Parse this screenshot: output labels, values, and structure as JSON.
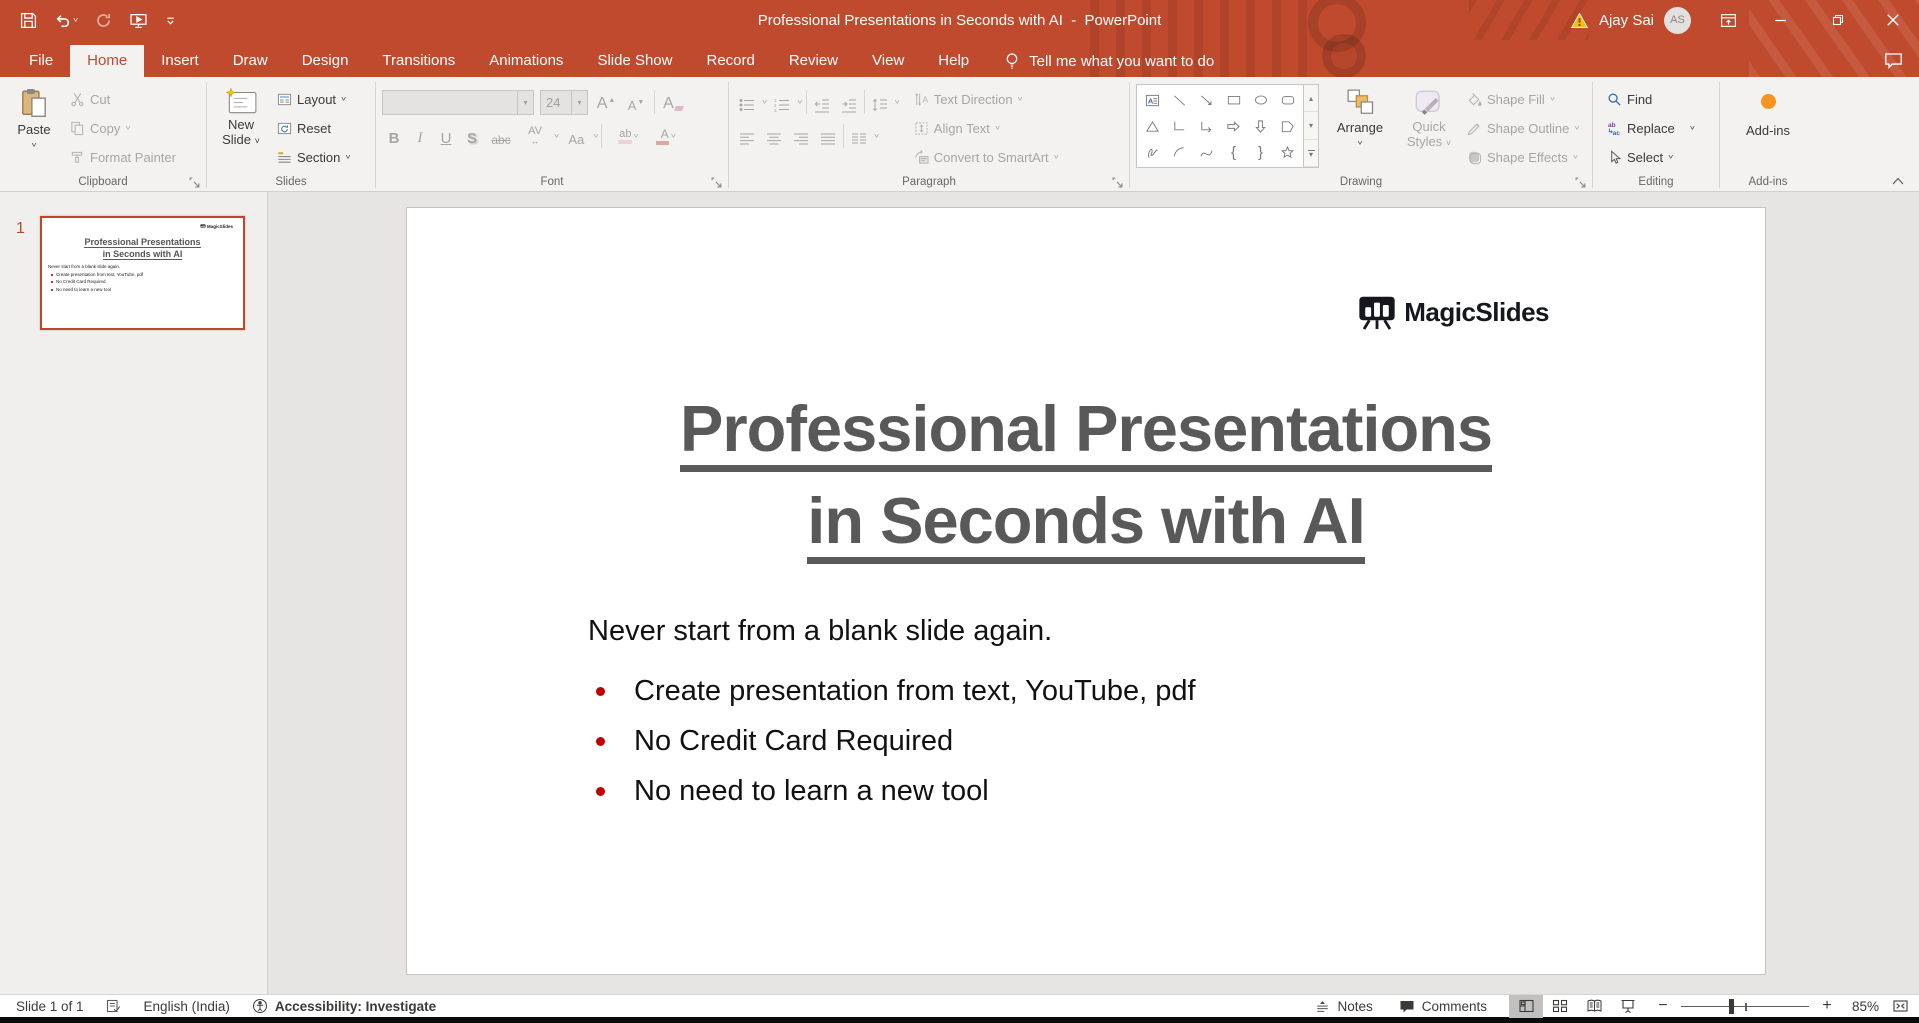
{
  "titlebar": {
    "title": "Professional Presentations in Seconds with AI  -  PowerPoint",
    "user_name": "Ajay Sai",
    "avatar_initials": "AS"
  },
  "menubar": {
    "tabs": [
      "File",
      "Home",
      "Insert",
      "Draw",
      "Design",
      "Transitions",
      "Animations",
      "Slide Show",
      "Record",
      "Review",
      "View",
      "Help"
    ],
    "tellme": "Tell me what you want to do"
  },
  "ribbon": {
    "clipboard": {
      "label": "Clipboard",
      "paste": "Paste",
      "cut": "Cut",
      "copy": "Copy",
      "format_painter": "Format Painter"
    },
    "slides": {
      "label": "Slides",
      "new_slide_line1": "New",
      "new_slide_line2": "Slide",
      "layout": "Layout",
      "reset": "Reset",
      "section": "Section"
    },
    "font": {
      "label": "Font",
      "size_value": "24",
      "bold": "B",
      "italic": "I",
      "underline": "U",
      "shadow": "S",
      "strikethrough": "abc",
      "char_spacing": "AV",
      "change_case": "Aa",
      "highlight": "ab",
      "font_color": "A",
      "clear": "A"
    },
    "paragraph": {
      "label": "Paragraph",
      "text_direction": "Text Direction",
      "align_text": "Align Text",
      "smartart": "Convert to SmartArt"
    },
    "drawing": {
      "label": "Drawing",
      "arrange": "Arrange",
      "quick_styles_line1": "Quick",
      "quick_styles_line2": "Styles",
      "shape_fill": "Shape Fill",
      "shape_outline": "Shape Outline",
      "shape_effects": "Shape Effects"
    },
    "editing": {
      "label": "Editing",
      "find": "Find",
      "replace": "Replace",
      "select": "Select"
    },
    "addins": {
      "label": "Add-ins",
      "button": "Add-ins"
    }
  },
  "thumbnails": {
    "slide_number": "1"
  },
  "slide": {
    "logo_text": "MagicSlides",
    "title_line1": "Professional Presentations",
    "title_line2": "in Seconds with AI",
    "subtitle": "Never start from a blank slide again.",
    "bullets": [
      "Create presentation from text, YouTube, pdf",
      "No Credit Card Required",
      "No need to learn a new tool"
    ]
  },
  "statusbar": {
    "slide_indicator": "Slide 1 of 1",
    "language": "English (India)",
    "accessibility": "Accessibility: Investigate",
    "notes": "Notes",
    "comments": "Comments",
    "zoom_level": "85%"
  }
}
